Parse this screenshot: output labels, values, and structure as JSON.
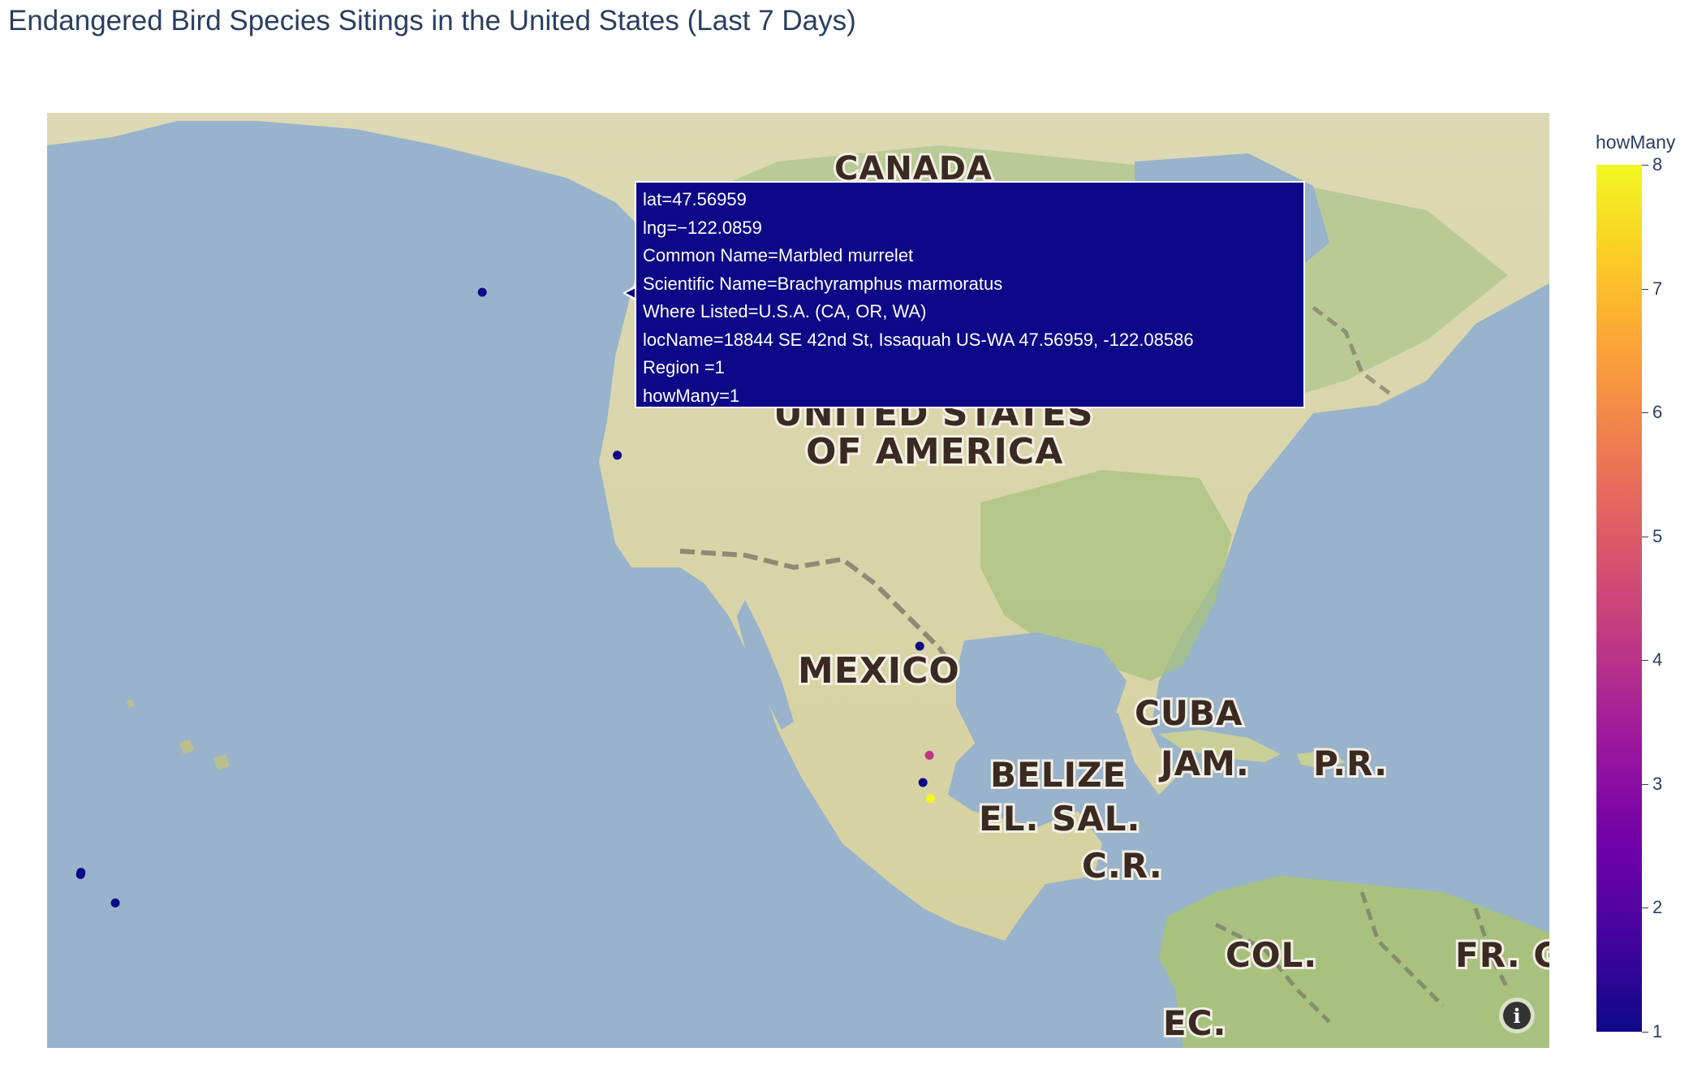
{
  "title": "Endangered Bird Species Sitings in the United States (Last 7 Days)",
  "map": {
    "country_labels": {
      "canada": "CANADA",
      "usa_line1": "UNITED STATES",
      "usa_line2": "OF AMERICA",
      "mexico": "MEXICO",
      "cuba": "CUBA",
      "jamaica": "JAM.",
      "puerto_rico": "P.R.",
      "belize": "BELIZE",
      "el_salvador": "EL. SAL.",
      "costa_rica": "C.R.",
      "colombia": "COL.",
      "french_guiana": "FR. G",
      "ecuador": "EC."
    },
    "colors": {
      "water": "#98b3cb",
      "land": "#d9d5a8",
      "forest": "#a9c17f"
    },
    "info_icon": "info-icon"
  },
  "points": [
    {
      "lat": 47.56959,
      "lng": -122.0859,
      "howMany": 1,
      "color": "#0d0887"
    },
    {
      "lat": 40.4,
      "lng": -109.5,
      "howMany": 1,
      "color": "#0d0887"
    },
    {
      "lat": 32.0,
      "lng": -81.3,
      "howMany": 1,
      "color": "#0d0887"
    },
    {
      "lat": 27.2,
      "lng": -80.4,
      "howMany": 4,
      "color": "#bd3786"
    },
    {
      "lat": 26.0,
      "lng": -81.0,
      "howMany": 1,
      "color": "#0d0887"
    },
    {
      "lat": 25.3,
      "lng": -80.3,
      "howMany": 8,
      "color": "#f0f921"
    },
    {
      "lat": 22.05,
      "lng": -159.5,
      "howMany": 1,
      "color": "#0d0887"
    },
    {
      "lat": 21.95,
      "lng": -159.55,
      "howMany": 1,
      "color": "#0d0887"
    },
    {
      "lat": 20.7,
      "lng": -156.3,
      "howMany": 1,
      "color": "#0d0887"
    }
  ],
  "tooltip": {
    "lines": [
      "lat=47.56959",
      "lng=−122.0859",
      "Common Name=Marbled murrelet",
      "Scientific Name=Brachyramphus marmoratus",
      "Where Listed=U.S.A. (CA, OR, WA)",
      "locName=18844 SE 42nd St, Issaquah US-WA 47.56959, -122.08586",
      "Region  =1",
      "howMany=1"
    ]
  },
  "colorbar": {
    "title": "howMany",
    "ticks": [
      "1",
      "2",
      "3",
      "4",
      "5",
      "6",
      "7",
      "8"
    ],
    "colorscale": [
      "#0d0887",
      "#46039f",
      "#7201a8",
      "#9c179e",
      "#bd3786",
      "#d8576b",
      "#ed7953",
      "#fb9f3a",
      "#fdca26",
      "#f0f921"
    ]
  }
}
